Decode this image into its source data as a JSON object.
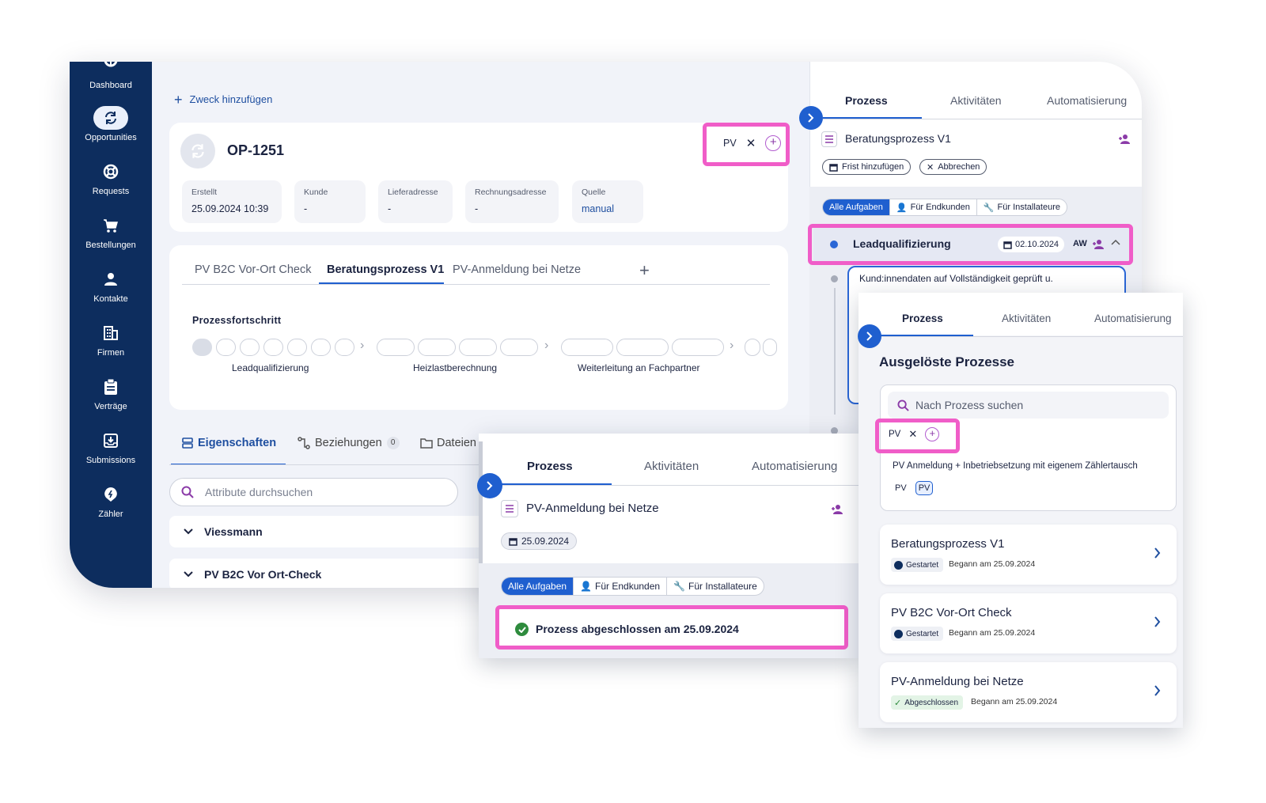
{
  "sidebar": {
    "items": [
      {
        "label": "Dashboard",
        "icon": "dashboard-icon"
      },
      {
        "label": "Opportunities",
        "icon": "sync-icon"
      },
      {
        "label": "Requests",
        "icon": "lifebuoy-icon"
      },
      {
        "label": "Bestellungen",
        "icon": "cart-icon"
      },
      {
        "label": "Kontakte",
        "icon": "person-icon"
      },
      {
        "label": "Firmen",
        "icon": "building-icon"
      },
      {
        "label": "Verträge",
        "icon": "clipboard-icon"
      },
      {
        "label": "Submissions",
        "icon": "inbox-icon"
      },
      {
        "label": "Zähler",
        "icon": "meter-icon"
      }
    ]
  },
  "main": {
    "add_purpose": "Zweck hinzufügen",
    "opportunity_id": "OP-1251",
    "tag": "PV",
    "meta": [
      {
        "label": "Erstellt",
        "value": "25.09.2024 10:39"
      },
      {
        "label": "Kunde",
        "value": "-"
      },
      {
        "label": "Lieferadresse",
        "value": "-"
      },
      {
        "label": "Rechnungsadresse",
        "value": "-"
      },
      {
        "label": "Quelle",
        "value": "manual"
      }
    ],
    "process_tabs": [
      "PV B2C Vor-Ort Check",
      "Beratungsprozess V1",
      "PV-Anmeldung bei Netze"
    ],
    "progress_title": "Prozessfortschritt",
    "progress_stages": [
      "Leadqualifizierung",
      "Heizlastberechnung",
      "Weiterleitung an Fachpartner"
    ],
    "bottom_tabs": {
      "eigenschaften": "Eigenschaften",
      "beziehungen": "Beziehungen",
      "beziehungen_count": "0",
      "dateien": "Dateien"
    },
    "search_placeholder": "Attribute durchsuchen",
    "sections": [
      "Viessmann",
      "PV B2C Vor Ort-Check"
    ]
  },
  "right_panel": {
    "tabs": [
      "Prozess",
      "Aktivitäten",
      "Automatisierung"
    ],
    "process_name": "Beratungsprozess V1",
    "add_deadline": "Frist hinzufügen",
    "cancel": "Abbrechen",
    "filters": [
      "Alle Aufgaben",
      "Für Endkunden",
      "Für Installateure"
    ],
    "task_title": "Leadqualifizierung",
    "task_date": "02.10.2024",
    "task_assignee": "AW",
    "subtask": "Kund:innendaten auf Vollständigkeit geprüft u."
  },
  "middle_panel": {
    "tabs": [
      "Prozess",
      "Aktivitäten",
      "Automatisierung"
    ],
    "process_name": "PV-Anmeldung bei Netze",
    "date": "25.09.2024",
    "filters": [
      "Alle Aufgaben",
      "Für Endkunden",
      "Für Installateure"
    ],
    "completed": "Prozess abgeschlossen am 25.09.2024"
  },
  "front_panel": {
    "tabs": [
      "Prozess",
      "Aktivitäten",
      "Automatisierung"
    ],
    "title": "Ausgelöste Prozesse",
    "search_placeholder": "Nach Prozess suchen",
    "tag": "PV",
    "suggestion": "PV Anmeldung + Inbetriebsetzung mit eigenem Zählertausch",
    "suggestion_tags": [
      "PV",
      "PV"
    ],
    "processes": [
      {
        "name": "Beratungsprozess V1",
        "status": "Gestartet",
        "began": "Begann am 25.09.2024"
      },
      {
        "name": "PV B2C Vor-Ort Check",
        "status": "Gestartet",
        "began": "Begann am 25.09.2024"
      },
      {
        "name": "PV-Anmeldung bei Netze",
        "status": "Abgeschlossen",
        "began": "Begann am 25.09.2024"
      }
    ]
  },
  "colors": {
    "sidebar": "#0d2d5e",
    "accent_blue": "#1f5fcf",
    "highlight_pink": "#f05dc8",
    "success_green": "#2e8b3d",
    "purple_icon": "#8b3ba8"
  }
}
